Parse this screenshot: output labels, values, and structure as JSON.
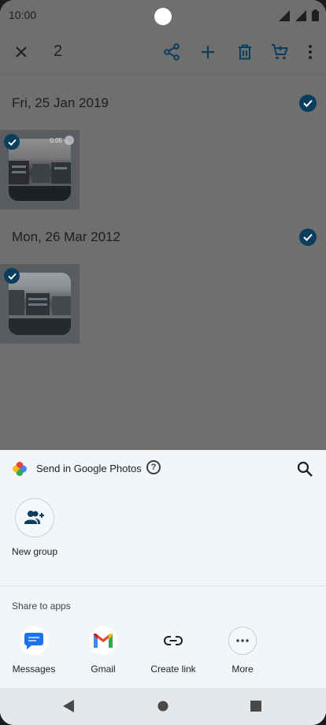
{
  "status": {
    "time": "10:00"
  },
  "appbar": {
    "selected_count": "2"
  },
  "groups": [
    {
      "date": "Fri, 25 Jan 2019",
      "item": {
        "duration": "0:05"
      }
    },
    {
      "date": "Mon, 26 Mar 2012"
    }
  ],
  "sheet": {
    "title": "Send in Google Photos",
    "help": "?",
    "new_group_label": "New group",
    "share_to_apps_label": "Share to apps",
    "apps": [
      {
        "label": "Messages",
        "icon": "messages-icon"
      },
      {
        "label": "Gmail",
        "icon": "gmail-icon"
      },
      {
        "label": "Create link",
        "icon": "link-icon"
      },
      {
        "label": "More",
        "icon": "more-icon"
      }
    ]
  },
  "colors": {
    "accent": "#0b3d5c",
    "sheet_bg": "#f2f6f9",
    "scrim": "#6f6f6f"
  }
}
